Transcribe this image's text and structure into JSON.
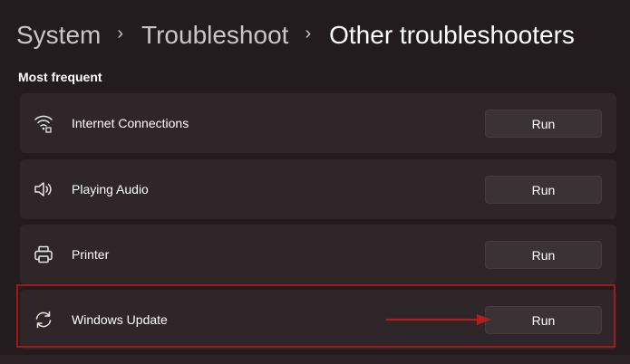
{
  "breadcrumb": {
    "items": [
      "System",
      "Troubleshoot",
      "Other troubleshooters"
    ],
    "separator": "›"
  },
  "section": {
    "title": "Most frequent"
  },
  "troubleshooters": [
    {
      "label": "Internet Connections",
      "icon": "wifi-icon",
      "button": "Run"
    },
    {
      "label": "Playing Audio",
      "icon": "speaker-icon",
      "button": "Run"
    },
    {
      "label": "Printer",
      "icon": "printer-icon",
      "button": "Run"
    },
    {
      "label": "Windows Update",
      "icon": "sync-icon",
      "button": "Run",
      "highlighted": true
    }
  ],
  "colors": {
    "background": "#231c1f",
    "card": "#2e2629",
    "button": "#3a3336",
    "highlight": "#9c1c1c"
  }
}
